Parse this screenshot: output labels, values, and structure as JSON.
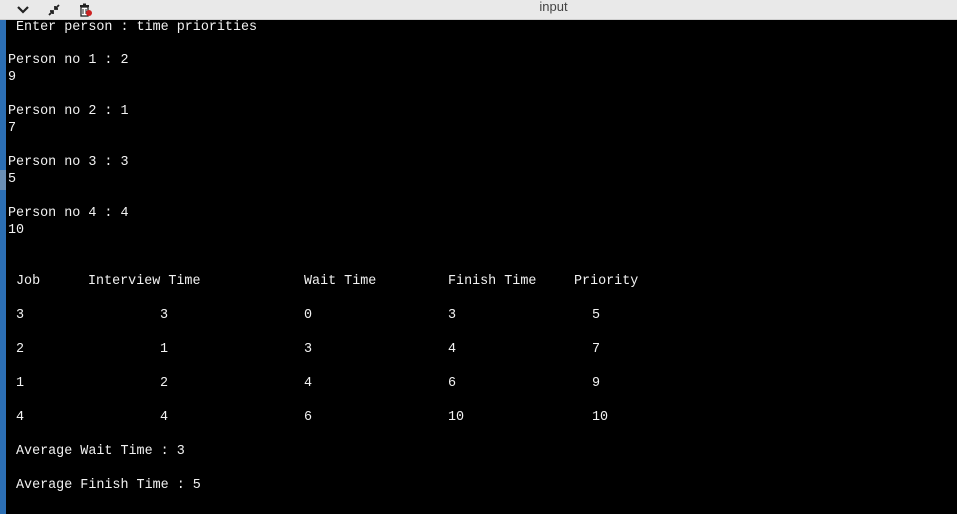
{
  "window": {
    "title": "input"
  },
  "toolbar": {
    "buttons": [
      {
        "name": "chevron-down-icon"
      },
      {
        "name": "shrink-icon"
      },
      {
        "name": "trash-icon"
      }
    ]
  },
  "console": {
    "prompt": "Enter person : time priorities",
    "entries": [
      {
        "label": "Person no 1 : 2",
        "value": "9"
      },
      {
        "label": "Person no 2 : 1",
        "value": "7"
      },
      {
        "label": "Person no 3 : 3",
        "value": "5"
      },
      {
        "label": "Person no 4 : 4",
        "value": "10"
      }
    ],
    "table": {
      "headers": [
        "Job",
        "Interview Time",
        "Wait Time",
        "Finish Time",
        "Priority"
      ],
      "rows": [
        [
          "3",
          "3",
          "0",
          "3",
          "5"
        ],
        [
          "2",
          "1",
          "3",
          "4",
          "7"
        ],
        [
          "1",
          "2",
          "4",
          "6",
          "9"
        ],
        [
          "4",
          "4",
          "6",
          "10",
          "10"
        ]
      ]
    },
    "avg_wait": "Average Wait Time : 3",
    "avg_finish": "Average Finish Time : 5"
  }
}
